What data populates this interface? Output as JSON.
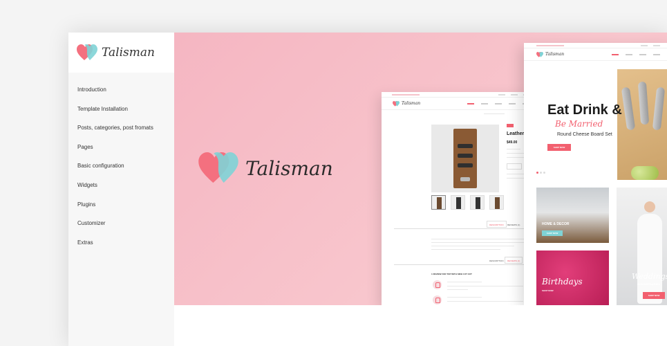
{
  "sidebar": {
    "brand": "Talisman",
    "items": [
      {
        "label": "Introduction"
      },
      {
        "label": "Template Installation"
      },
      {
        "label": "Posts, categories, post fromats"
      },
      {
        "label": "Pages"
      },
      {
        "label": "Basic configuration"
      },
      {
        "label": "Widgets"
      },
      {
        "label": "Plugins"
      },
      {
        "label": "Customizer"
      },
      {
        "label": "Extras"
      }
    ]
  },
  "hero": {
    "brand": "Talisman",
    "background": "#f7c1c9"
  },
  "product_mock": {
    "brand": "Talisman",
    "title": "Leather",
    "price": "$49.00",
    "tab_description": "DESCRIPTION",
    "tab_reviews": "REVIEWS (1)",
    "review_heading": "1 REVIEW FOR TOP WITH SIDE CUT OUT"
  },
  "home_mock": {
    "brand": "Talisman",
    "slide_title": "Eat Drink &",
    "slide_script": "Be Married",
    "slide_subtitle": "Round Cheese Board Set",
    "shop_now": "SHOP NOW",
    "tile_home_decor": "HOME & DECOR",
    "tile_birthdays": "Birthdays",
    "tile_weddings": "Weddings",
    "tile_anniversaries": "ANNIVERSARIES"
  },
  "colors": {
    "accent": "#f2606f",
    "heart_pink": "#f4707f",
    "heart_teal": "#7fd3d6"
  }
}
